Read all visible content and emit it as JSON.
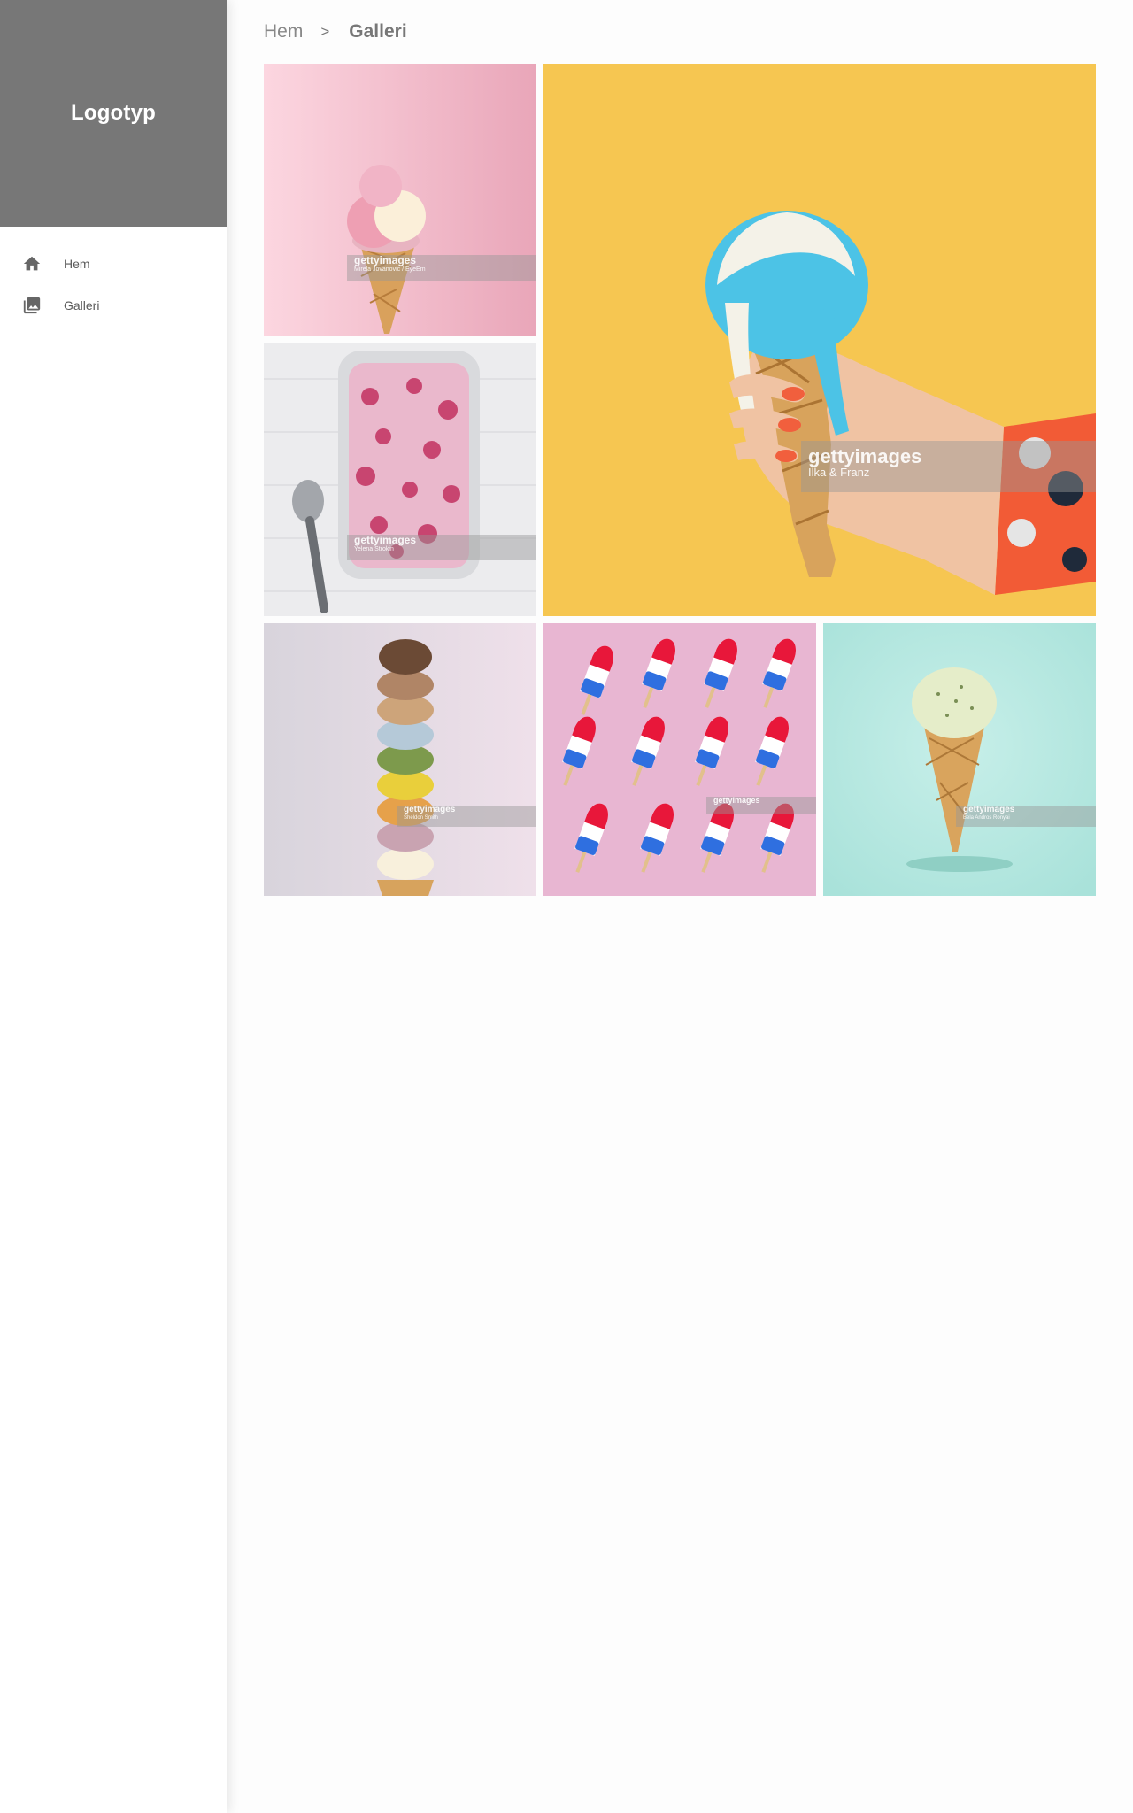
{
  "sidebar": {
    "logo": "Logotyp",
    "items": [
      {
        "label": "Hem",
        "icon": "home-icon"
      },
      {
        "label": "Galleri",
        "icon": "photo-library-icon"
      }
    ]
  },
  "breadcrumb": {
    "home": "Hem",
    "separator": ">",
    "current": "Galleri"
  },
  "gallery": {
    "images": [
      {
        "subject": "pink-ice-cream-cone",
        "background": "#f4c2cf",
        "watermark": "gettyimages",
        "credit": "Mirela Jovanovic / EyeEm"
      },
      {
        "subject": "melting-blue-ice-cream-cone-in-hand",
        "background": "#f6c64f",
        "watermark": "gettyimages",
        "credit": "Ilka & Franz"
      },
      {
        "subject": "raspberry-ice-cream-tub",
        "background": "#e9e9ea",
        "watermark": "gettyimages",
        "credit": "Yelena Strokin"
      },
      {
        "subject": "stacked-ice-cream-scoops",
        "background": "#e9dde6",
        "watermark": "gettyimages",
        "credit": "Sheldon Smith"
      },
      {
        "subject": "rocket-popsicles-pattern",
        "background": "#e7b7d3",
        "watermark": "gettyimages",
        "credit": ""
      },
      {
        "subject": "pistachio-ice-cream-cone",
        "background": "#bde9e2",
        "watermark": "gettyimages",
        "credit": "Bela Andros Ronyai"
      }
    ]
  }
}
